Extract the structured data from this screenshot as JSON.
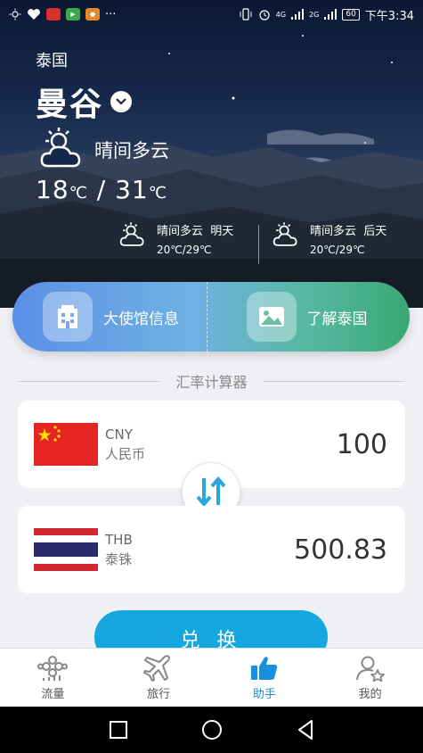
{
  "status_bar": {
    "time": "下午3:34",
    "battery": "60",
    "net1": "4G",
    "net2": "2G",
    "overflow": "···"
  },
  "weather": {
    "country": "泰国",
    "city": "曼谷",
    "condition": "晴间多云",
    "temp_low": "18",
    "temp_high": "31",
    "temp_unit": "℃",
    "temp_sep": "/",
    "forecast": [
      {
        "condition": "晴间多云",
        "day": "明天",
        "range": "20℃/29℃"
      },
      {
        "condition": "晴间多云",
        "day": "后天",
        "range": "20℃/29℃"
      }
    ]
  },
  "quick_links": [
    {
      "label": "大使馆信息",
      "icon": "building-icon"
    },
    {
      "label": "了解泰国",
      "icon": "landscape-icon"
    }
  ],
  "exchange": {
    "title": "汇率计算器",
    "from": {
      "code": "CNY",
      "name": "人民币",
      "amount": "100"
    },
    "to": {
      "code": "THB",
      "name": "泰铢",
      "amount": "500.83"
    },
    "button": "兑 换"
  },
  "bottom_nav": [
    {
      "label": "流量",
      "icon": "data-traffic-icon",
      "active": false
    },
    {
      "label": "旅行",
      "icon": "plane-icon",
      "active": false
    },
    {
      "label": "助手",
      "icon": "thumbs-up-icon",
      "active": true
    },
    {
      "label": "我的",
      "icon": "user-star-icon",
      "active": false
    }
  ],
  "colors": {
    "accent": "#1a8fe0",
    "exchange_button": "#16a7e0",
    "card_gradient_start": "#5b8fe6",
    "card_gradient_end": "#3aa776"
  }
}
